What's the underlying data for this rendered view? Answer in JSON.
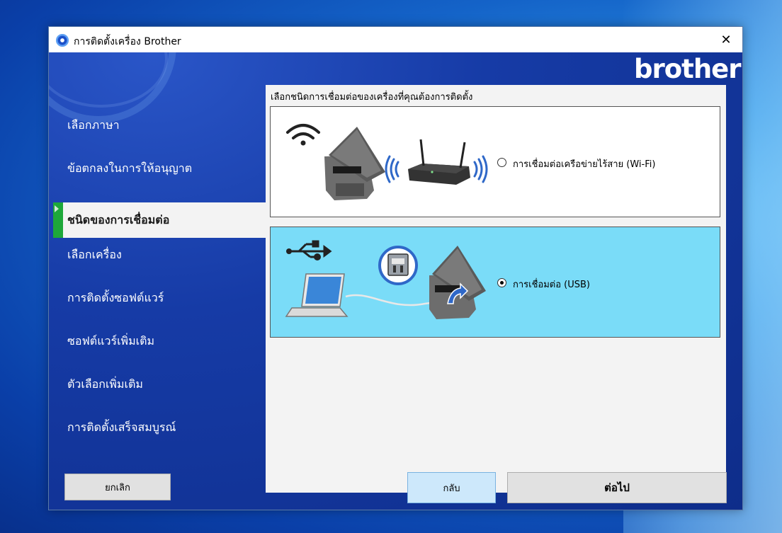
{
  "window": {
    "title": "การติดตั้งเครื่อง Brother",
    "close_glyph": "✕"
  },
  "brand": {
    "logo_text": "brother"
  },
  "nav": {
    "items": [
      {
        "label": "เลือกภาษา"
      },
      {
        "label": "ข้อตกลงในการให้อนุญาต"
      },
      {
        "label": "ชนิดของการเชื่อมต่อ",
        "active": true
      },
      {
        "label": "เลือกเครื่อง"
      },
      {
        "label": "การติดตั้งซอฟต์แวร์"
      },
      {
        "label": "ซอฟต์แวร์เพิ่มเติม"
      },
      {
        "label": "ตัวเลือกเพิ่มเติม"
      },
      {
        "label": "การติดตั้งเสร็จสมบูรณ์"
      }
    ]
  },
  "content": {
    "prompt": "เลือกชนิดการเชื่อมต่อของเครื่องที่คุณต้องการติดตั้ง",
    "options": [
      {
        "label": "การเชื่อมต่อเครือข่ายไร้สาย (Wi-Fi)",
        "selected": false,
        "icon": "wifi-router-icon"
      },
      {
        "label": "การเชื่อมต่อ (USB)",
        "selected": true,
        "icon": "usb-laptop-icon"
      }
    ]
  },
  "buttons": {
    "cancel": "ยกเลิก",
    "back": "กลับ",
    "next": "ต่อไป"
  },
  "colors": {
    "active_marker": "#1ea83a",
    "selected_option_bg": "#7adcf8",
    "back_button_bg": "#cde8fb"
  }
}
